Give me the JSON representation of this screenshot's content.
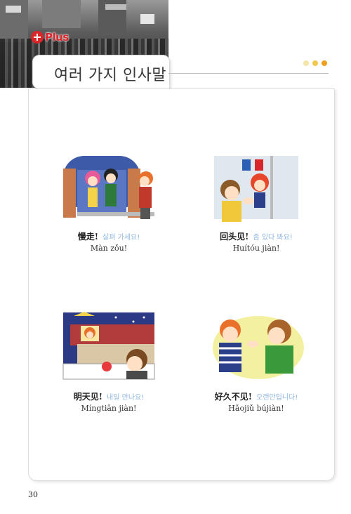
{
  "badge": {
    "icon": "+",
    "label": "Plus"
  },
  "title": "여러 가지 인사말",
  "dots": [
    "#f3e4a8",
    "#f2c84e",
    "#eda01f"
  ],
  "phrases": [
    {
      "chinese": "慢走!",
      "korean": "살펴 가세요!",
      "pinyin": "Màn zǒu!"
    },
    {
      "chinese": "回头见!",
      "korean": "좀 있다 봐요!",
      "pinyin": "Huítóu jiàn!"
    },
    {
      "chinese": "明天见!",
      "korean": "내일 만나요!",
      "pinyin": "Míngtiān jiàn!"
    },
    {
      "chinese": "好久不见!",
      "korean": "오랜만입니다!",
      "pinyin": "Hǎojiǔ bújiàn!"
    }
  ],
  "page_number": "30"
}
